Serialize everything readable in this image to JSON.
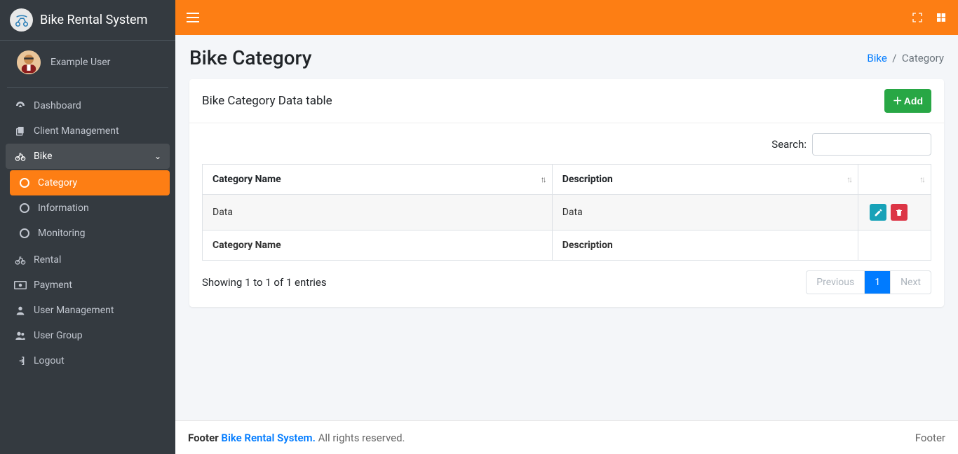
{
  "brand": {
    "title": "Bike Rental System"
  },
  "user": {
    "name": "Example User"
  },
  "sidebar": {
    "items": [
      {
        "label": "Dashboard"
      },
      {
        "label": "Client Management"
      },
      {
        "label": "Bike"
      },
      {
        "label": "Rental"
      },
      {
        "label": "Payment"
      },
      {
        "label": "User Management"
      },
      {
        "label": "User Group"
      },
      {
        "label": "Logout"
      }
    ],
    "bike_sub": [
      {
        "label": "Category"
      },
      {
        "label": "Information"
      },
      {
        "label": "Monitoring"
      }
    ]
  },
  "page": {
    "title": "Bike Category",
    "breadcrumb_root": "Bike",
    "breadcrumb_current": "Category"
  },
  "card": {
    "title": "Bike Category Data table",
    "add_label": "Add",
    "search_label": "Search:",
    "search_value": ""
  },
  "table": {
    "cols": {
      "name": "Category Name",
      "desc": "Description"
    },
    "rows": [
      {
        "name": "Data",
        "desc": "Data"
      }
    ],
    "footer": {
      "name": "Category Name",
      "desc": "Description"
    },
    "info": "Showing 1 to 1 of 1 entries",
    "pager": {
      "prev": "Previous",
      "p1": "1",
      "next": "Next"
    }
  },
  "footer": {
    "left_strong": "Footer",
    "link": "Bike Rental System.",
    "rights": "All rights reserved.",
    "right": "Footer"
  }
}
